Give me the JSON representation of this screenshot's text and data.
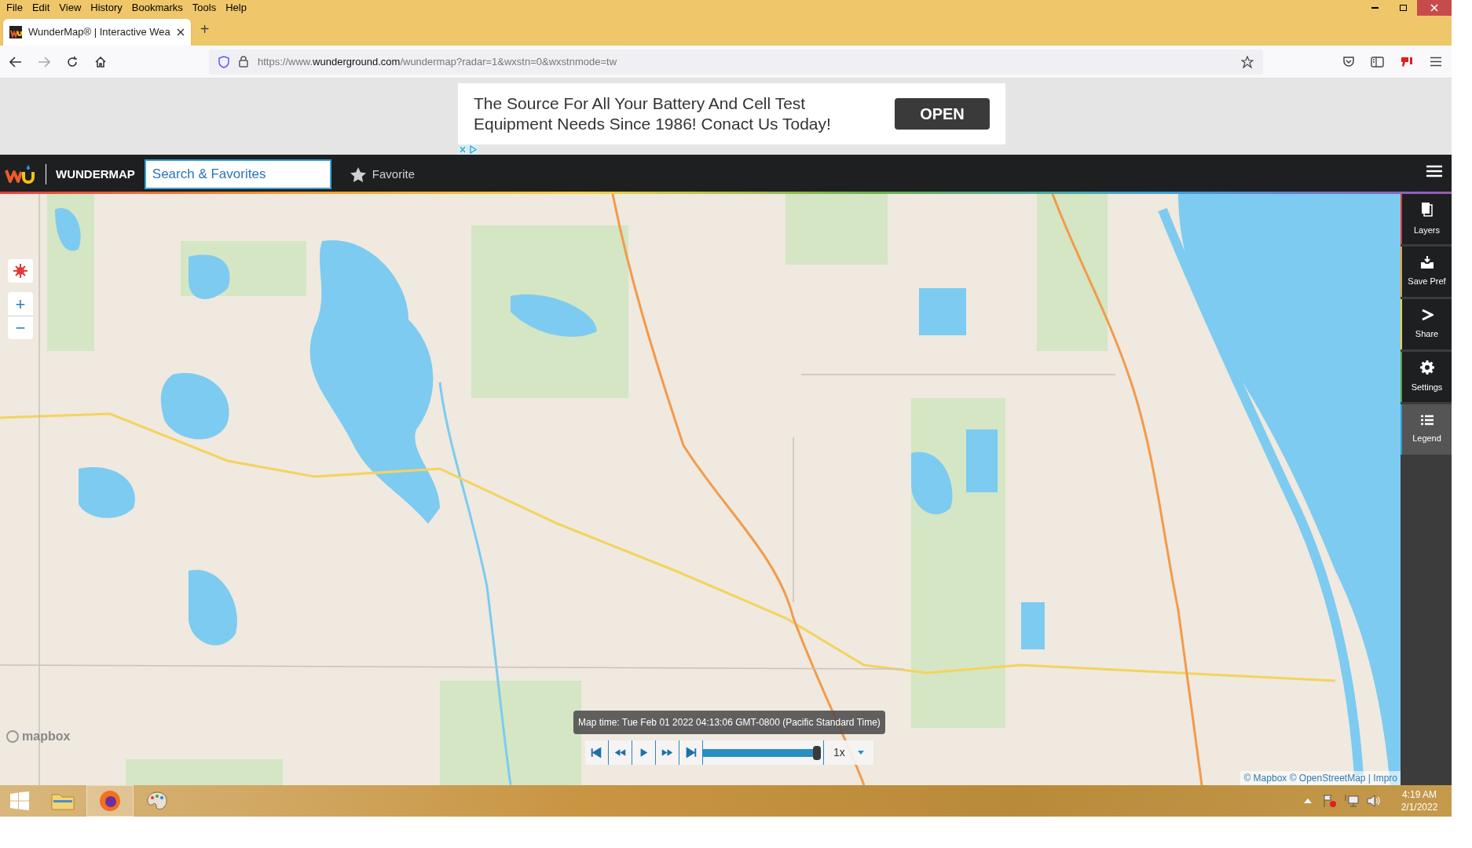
{
  "menu_bar": [
    "File",
    "Edit",
    "View",
    "History",
    "Bookmarks",
    "Tools",
    "Help"
  ],
  "tabs": [
    {
      "title": "WunderMap® | Interactive Wea",
      "selected": true
    }
  ],
  "new_tab": "+",
  "address_bar": {
    "scheme": "https://www.",
    "domain": "wunderground.com",
    "path": "/wundermap?radar=1&wxstn=0&wxstnmode=tw"
  },
  "ad": {
    "text": "The Source For All Your Battery And Cell Test Equipment Needs Since 1986! Conact Us Today!",
    "button": "OPEN"
  },
  "app_header": {
    "brand": "WUNDERMAP",
    "search": {
      "placeholder": "Search & Favorites"
    },
    "favorite": "Favorite"
  },
  "sidebar": [
    {
      "kind": "layers",
      "label": "Layers",
      "selected": false
    },
    {
      "kind": "save",
      "label": "Save Pref",
      "selected": false
    },
    {
      "kind": "share",
      "label": "Share",
      "selected": false
    },
    {
      "kind": "settings",
      "label": "Settings",
      "selected": false
    },
    {
      "kind": "legend",
      "label": "Legend",
      "selected": true
    }
  ],
  "map_controls": {
    "zoom_in": "+",
    "zoom_out": "−"
  },
  "player": {
    "map_time": "Map time: Tue Feb 01 2022 04:13:06 GMT-0800 (Pacific Standard Time)",
    "level": 1,
    "speed": "1x"
  },
  "mapbox_logo": "mapbox",
  "attribution": "© Mapbox © OpenStreetMap | Impro",
  "taskbar": {
    "time": "4:19 AM",
    "date": "2/1/2022"
  }
}
